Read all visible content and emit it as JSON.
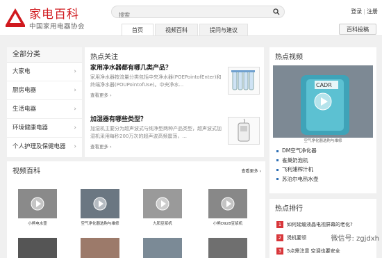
{
  "header": {
    "brand": "家电百科",
    "brand_sub": "中国家用电器协会",
    "search_placeholder": "搜索",
    "login": "登录",
    "register": "注册",
    "nav_tabs": [
      "首页",
      "视频百科",
      "提问与建议"
    ],
    "post_button": "百科投稿",
    "accent_color": "#d0191e"
  },
  "categories": {
    "title": "全部分类",
    "items": [
      "大家电",
      "厨房电器",
      "生活电器",
      "环境健康电器",
      "个人护理及保健电器"
    ]
  },
  "hot_topics": {
    "title": "热点关注",
    "articles": [
      {
        "title": "家用净水器都有哪几类产品？",
        "body": "家用净水器按流量分类包括中央净水器(POEPointofEnter)和终端净水器(POUPointofUse)。中央净水...",
        "more": "查看更多"
      },
      {
        "title": "加湿器有哪些类型？",
        "body": "加湿机主要分为超声波式与纯净型两种产品类型，超声波式加湿机采用每秒200万次的超声波高频震荡，...",
        "more": "查看更多"
      }
    ]
  },
  "hot_video": {
    "title": "热点视频",
    "caption": "空气净化器选购与维修",
    "screen_label": "CADR",
    "list": [
      "DM空气净化器",
      "雀巢奶泡机",
      "飞利浦榨汁机",
      "苏泊尔电热水壶"
    ]
  },
  "videos": {
    "title": "视频百科",
    "more": "查看更多",
    "items": [
      "小熊电水壶",
      "空气净化器选购与维修",
      "九阳豆浆机",
      "小熊D928豆浆机"
    ]
  },
  "ranking": {
    "title": "热点排行",
    "rows": [
      {
        "num": "1",
        "text": "如何延缓液晶电视屏幕的老化?"
      },
      {
        "num": "2",
        "text": "煲机要领"
      },
      {
        "num": "3",
        "text": "5点需注意 空调也要安全"
      }
    ]
  },
  "watermark": "微信号: zgjdxh"
}
